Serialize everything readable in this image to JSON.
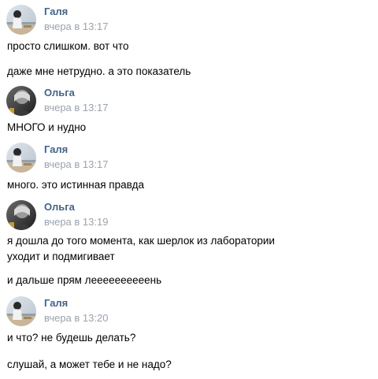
{
  "messages": [
    {
      "author": "Галя",
      "avatar_icon": "galya-avatar-icon",
      "time": "вчера в 13:17",
      "lines": [
        "просто слишком. вот что",
        "даже мне нетрудно. а это показатель"
      ]
    },
    {
      "author": "Ольга",
      "avatar_icon": "olga-avatar-icon",
      "time": "вчера в 13:17",
      "lines": [
        "МНОГО и нудно"
      ]
    },
    {
      "author": "Галя",
      "avatar_icon": "galya-avatar-icon",
      "time": "вчера в 13:17",
      "lines": [
        "много. это истинная правда"
      ]
    },
    {
      "author": "Ольга",
      "avatar_icon": "olga-avatar-icon",
      "time": "вчера в 13:19",
      "lines": [
        "я дошла до того момента, как шерлок из лаборатории\nуходит и подмигивает",
        "и дальше прям леееееееееень"
      ]
    },
    {
      "author": "Галя",
      "avatar_icon": "galya-avatar-icon",
      "time": "вчера в 13:20",
      "lines": [
        "и что? не будешь делать?",
        "слушай, а может тебе и не надо?"
      ]
    }
  ],
  "colors": {
    "author": "#42648b",
    "time": "#9ba3ac",
    "text": "#000000",
    "background": "#ffffff"
  }
}
